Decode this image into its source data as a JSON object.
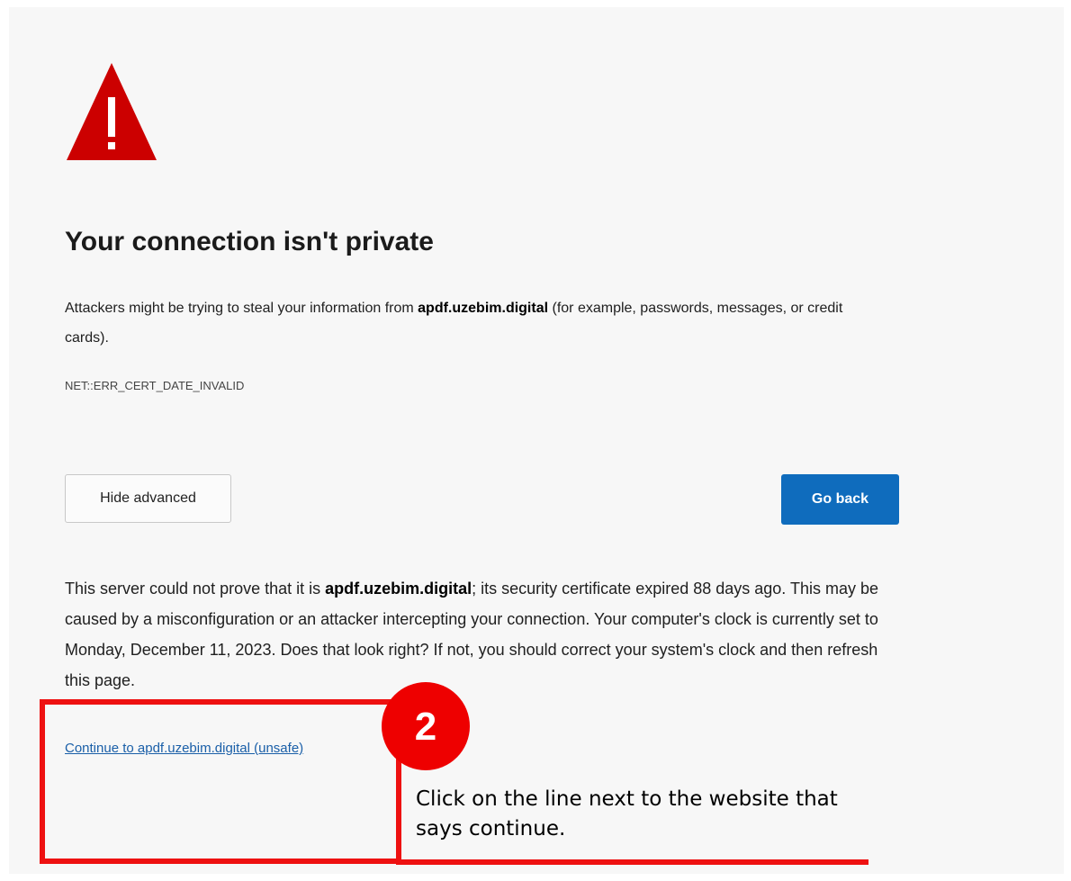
{
  "error_page": {
    "icon": "warning-triangle-icon",
    "icon_color": "#cc0000",
    "title": "Your connection isn't private",
    "desc_before": "Attackers might be trying to steal your information from ",
    "desc_domain": "apdf.uzebim.digital",
    "desc_after": " (for example, passwords, messages, or credit cards).",
    "error_code": "NET::ERR_CERT_DATE_INVALID",
    "hide_advanced_label": "Hide advanced",
    "go_back_label": "Go back",
    "go_back_color": "#0f6cbd",
    "details_before": "This server could not prove that it is ",
    "details_domain": "apdf.uzebim.digital",
    "details_after": "; its security certificate expired 88 days ago. This may be caused by a misconfiguration or an attacker intercepting your connection. Your computer's clock is currently set to Monday, December 11, 2023. Does that look right? If not, you should correct your system's clock and then refresh this page.",
    "continue_link": "Continue to apdf.uzebim.digital (unsafe)"
  },
  "annotation": {
    "step_number": "2",
    "instruction": "Click on the line next to the website that says continue.",
    "highlight_color": "#ee1111"
  }
}
